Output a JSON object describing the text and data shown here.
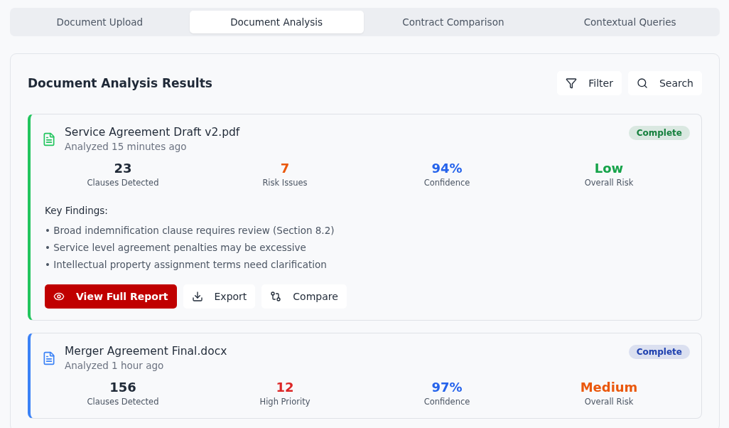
{
  "tabs": [
    {
      "label": "Document Upload",
      "selected": false
    },
    {
      "label": "Document Analysis",
      "selected": true
    },
    {
      "label": "Contract Comparison",
      "selected": false
    },
    {
      "label": "Contextual Queries",
      "selected": false
    }
  ],
  "panel": {
    "title": "Document Analysis Results",
    "actions": [
      {
        "kind": "filter",
        "label": "Filter"
      },
      {
        "kind": "search",
        "label": "Search"
      }
    ]
  },
  "documents": [
    {
      "name": "Service Agreement Draft v2.pdf",
      "analyzed": "Analyzed 15 minutes ago",
      "color": "#22c55e",
      "status": {
        "label": "Complete",
        "color": "#15803d"
      },
      "stats": [
        {
          "value": "23",
          "label": "Clauses Detected",
          "color": "#1f2937"
        },
        {
          "value": "7",
          "label": "Risk Issues",
          "color": "#ea580c"
        },
        {
          "value": "94%",
          "label": "Confidence",
          "color": "#2563eb"
        },
        {
          "value": "Low",
          "label": "Overall Risk",
          "color": "#16a34a"
        }
      ],
      "findings_title": "Key Findings:",
      "findings": [
        "• Broad indemnification clause requires review (Section 8.2)",
        "• Service level agreement penalties may be excessive",
        "• Intellectual property assignment terms need clarification"
      ],
      "buttons": [
        {
          "kind": "view",
          "label": "View Full Report"
        },
        {
          "kind": "export",
          "label": "Export"
        },
        {
          "kind": "compare",
          "label": "Compare"
        }
      ]
    },
    {
      "name": "Merger Agreement Final.docx",
      "analyzed": "Analyzed 1 hour ago",
      "color": "#3b82f6",
      "status": {
        "label": "Complete",
        "color": "#1e40af"
      },
      "stats": [
        {
          "value": "156",
          "label": "Clauses Detected",
          "color": "#1f2937"
        },
        {
          "value": "12",
          "label": "High Priority",
          "color": "#dc2626"
        },
        {
          "value": "97%",
          "label": "Confidence",
          "color": "#2563eb"
        },
        {
          "value": "Medium",
          "label": "Overall Risk",
          "color": "#ea580c"
        }
      ]
    }
  ]
}
